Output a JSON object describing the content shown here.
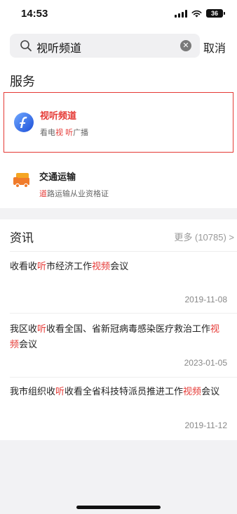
{
  "status_bar": {
    "time": "14:53",
    "battery": "36"
  },
  "search": {
    "query": "视听频道",
    "cancel_label": "取消"
  },
  "services_section": {
    "title": "服务",
    "items": [
      {
        "name": "视听频道",
        "desc_segments": [
          "看电",
          "视",
          " ",
          "听",
          "广播"
        ]
      },
      {
        "name": "交通运输",
        "desc_segments": [
          "道",
          "路运输从业资格证"
        ]
      }
    ]
  },
  "news_section": {
    "title": "资讯",
    "more_label": "更多 (10785) >",
    "items": [
      {
        "title_segments": [
          "收看收",
          "听",
          "市经济工作",
          "视频",
          "会议"
        ],
        "date": "2019-11-08"
      },
      {
        "title_segments": [
          "我区收",
          "听",
          "收看全国、省新冠病毒感染医疗救治工作",
          "视频",
          "会议"
        ],
        "date": "2023-01-05"
      },
      {
        "title_segments": [
          "我市组织收",
          "听",
          "收看全省科技特派员推进工作",
          "视频",
          "会议"
        ],
        "date": "2019-11-12"
      }
    ]
  },
  "colors": {
    "accent_red": "#e53935",
    "background_gray": "#f2f2f4"
  },
  "icons": {
    "search": "search-icon",
    "clear": "clear-icon",
    "service_1": "flash-logo-icon",
    "service_2": "truck-icon"
  }
}
